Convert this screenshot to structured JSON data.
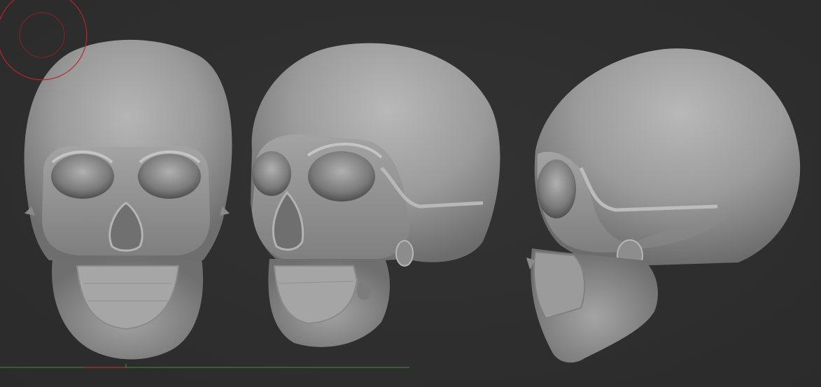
{
  "viewport": {
    "background": "#2e2e2e",
    "model_color": "#9a9a9a",
    "brush_cursor_color": "#b8262b",
    "ground_axis_x_color": "#c0392b",
    "ground_axis_z_color": "#3f8f3f"
  },
  "models": [
    {
      "view": "front"
    },
    {
      "view": "three-quarter"
    },
    {
      "view": "side"
    }
  ]
}
